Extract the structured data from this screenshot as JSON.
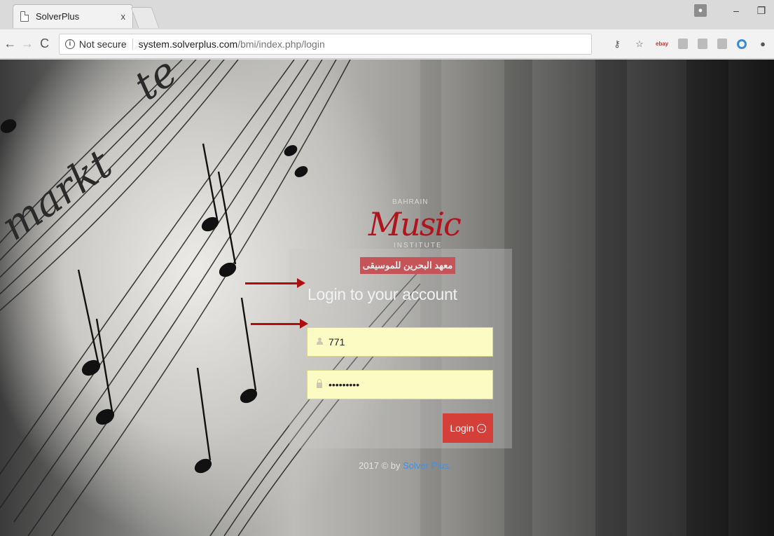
{
  "browser": {
    "tab_title": "SolverPlus",
    "tab_close": "x",
    "profile_icon": "person-icon",
    "minimize": "–",
    "restore": "❐",
    "nav": {
      "back": "←",
      "forward": "→",
      "reload": "C"
    },
    "security_label": "Not secure",
    "url_host": "system.solverplus.com",
    "url_path": "/bmi/index.php/login",
    "star": "☆",
    "key": "⚷",
    "ebay": "ebay"
  },
  "logo": {
    "bahrain": "BAHRAIN",
    "music": "Music",
    "institute": "INSTITUTE",
    "arabic": "معهد البحرين للموسيقى"
  },
  "login": {
    "title": "Login to your account",
    "username_value": "771",
    "password_value": "•••••••••",
    "button_label": "Login",
    "button_icon": "→"
  },
  "footer": {
    "prefix": "2017 © by ",
    "brand": "Solver Plus."
  },
  "colors": {
    "accent_red": "#d43f3a",
    "field_bg": "#fbfbc4",
    "link_blue": "#4a90d9"
  }
}
